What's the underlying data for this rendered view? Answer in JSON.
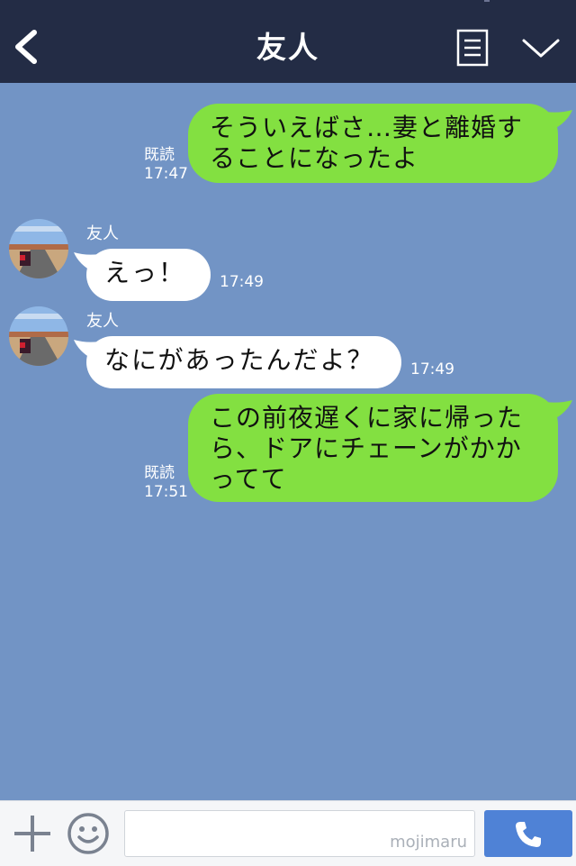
{
  "header": {
    "title": "友人",
    "icons": {
      "back": "back-arrow-icon",
      "notes": "notes-icon",
      "menu": "chevron-down-icon"
    },
    "bg_color": "#232c45"
  },
  "chat": {
    "bg_color": "#7294c5",
    "messages": [
      {
        "from": "me",
        "text_lines": [
          "そういえばさ…妻と離婚す",
          "ることになったよ"
        ],
        "read_label": "既読",
        "time": "17:47"
      },
      {
        "from": "friend",
        "sender": "友人",
        "text": "えっ！",
        "time": "17:49"
      },
      {
        "from": "friend",
        "sender": "友人",
        "text": "なにがあったんだよ？",
        "time": "17:49"
      },
      {
        "from": "me",
        "text_lines": [
          "この前夜遅くに家に帰った",
          "ら、ドアにチェーンがかか",
          "ってて"
        ],
        "read_label": "既読",
        "time": "17:51"
      }
    ],
    "colors": {
      "my_bubble": "#83e041",
      "friend_bubble": "#ffffff"
    }
  },
  "footer": {
    "input_watermark": "mojimaru",
    "icons": {
      "plus": "plus-icon",
      "emoji": "smile-icon",
      "call": "phone-icon"
    },
    "call_color": "#4f82d6"
  }
}
